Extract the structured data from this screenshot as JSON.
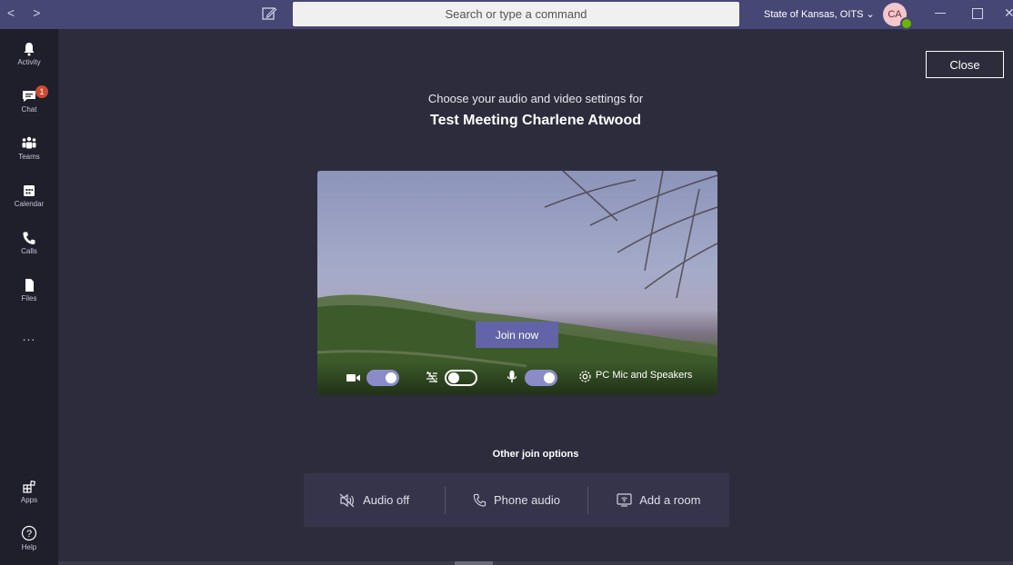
{
  "titlebar": {
    "search_placeholder": "Search or type a command",
    "org_label": "State of Kansas, OITS ⌄",
    "avatar_initials": "CA"
  },
  "rail": {
    "items": [
      {
        "label": "Activity",
        "icon": "bell-icon"
      },
      {
        "label": "Chat",
        "icon": "chat-icon",
        "badge": "1"
      },
      {
        "label": "Teams",
        "icon": "teams-icon"
      },
      {
        "label": "Calendar",
        "icon": "calendar-icon"
      },
      {
        "label": "Calls",
        "icon": "phone-icon"
      },
      {
        "label": "Files",
        "icon": "file-icon"
      }
    ],
    "more_label": "...",
    "bottom_items": [
      {
        "label": "Apps",
        "icon": "apps-icon"
      },
      {
        "label": "Help",
        "icon": "help-icon"
      }
    ]
  },
  "main": {
    "close_label": "Close",
    "subtitle": "Choose your audio and video settings for",
    "meeting_title": "Test Meeting Charlene Atwood",
    "join_label": "Join now",
    "controls": {
      "camera_on": true,
      "blur_on": false,
      "mic_on": true,
      "device_label": "PC Mic and Speakers"
    },
    "other_join_title": "Other join options",
    "options": [
      {
        "label": "Audio off",
        "icon": "speaker-off-icon"
      },
      {
        "label": "Phone audio",
        "icon": "phone-icon"
      },
      {
        "label": "Add a room",
        "icon": "room-icon"
      }
    ]
  },
  "colors": {
    "titlebar": "#464775",
    "rail": "#1f1e2b",
    "background": "#2d2c3c",
    "accent": "#6264a7",
    "badge": "#cc4a31"
  }
}
